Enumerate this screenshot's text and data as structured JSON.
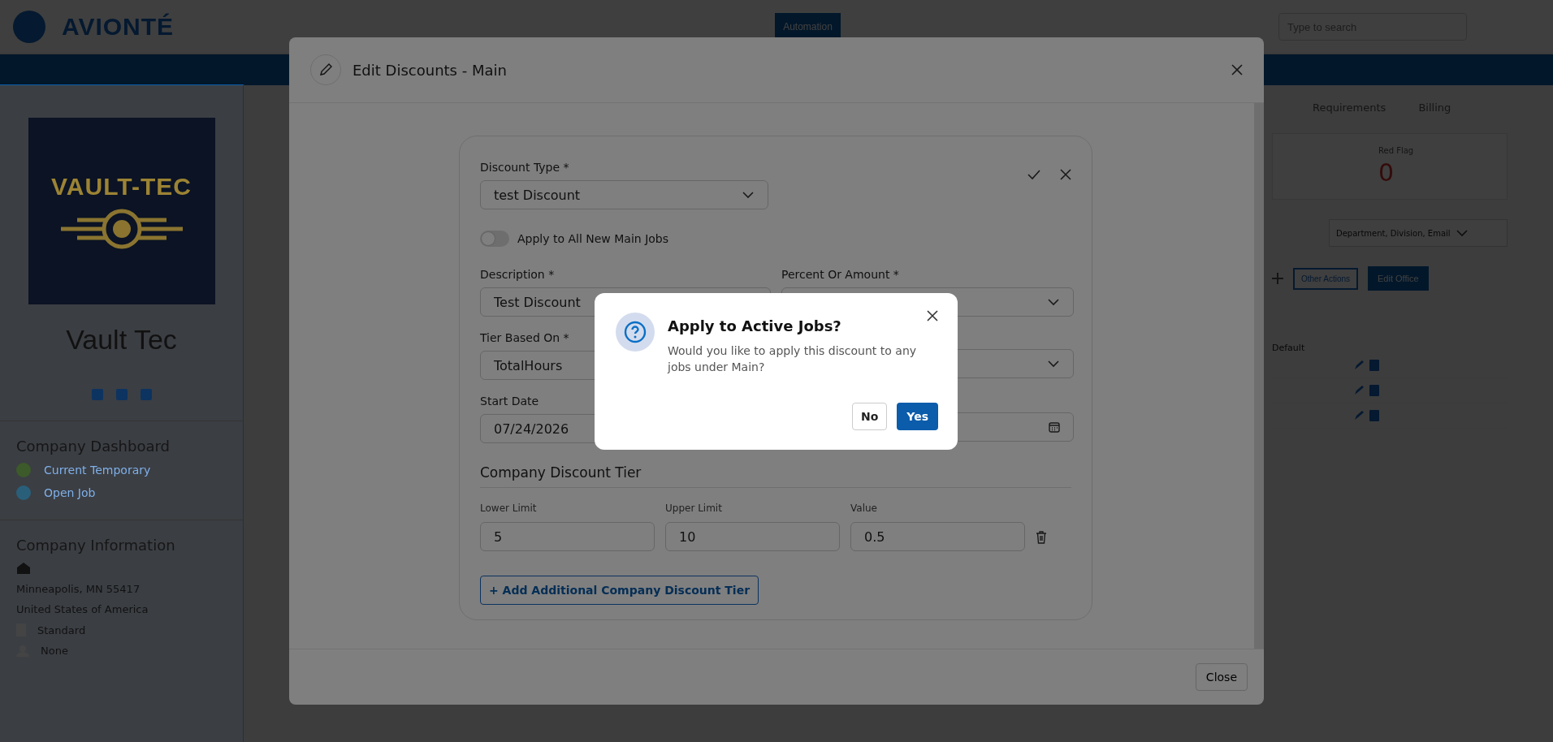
{
  "header": {
    "logo": "AVIONTÉ",
    "nav_button": "Automation",
    "search": {
      "placeholder": "Type to search"
    }
  },
  "sidebar": {
    "company_name": "Vault Tec",
    "logo_text": "VAULT-TEC",
    "dashboard_title": "Company Dashboard",
    "dashboard_items": [
      {
        "label": "Current Temporary",
        "color": "#3d5a2a"
      },
      {
        "label": "Open Job",
        "color": "#2a5f7a"
      }
    ],
    "info_title": "Company Information",
    "address_lines": [
      "Minneapolis, MN 55417",
      "United States of America"
    ],
    "attributes": [
      {
        "kind": "book",
        "label": "Standard"
      },
      {
        "kind": "person",
        "label": "None"
      }
    ]
  },
  "main": {
    "tabs": [
      "Requirements",
      "Billing"
    ],
    "stat": {
      "label": "Red Flag",
      "value": "0"
    },
    "filter": "Department, Division, Email",
    "other_actions": "Other Actions",
    "edit_office": "Edit Office",
    "table_header": "Default"
  },
  "modal": {
    "title": "Edit Discounts - Main",
    "close_button": "Close",
    "form": {
      "discount_type": {
        "label": "Discount Type *",
        "value": "test Discount"
      },
      "toggle": {
        "label": "Apply to All New Main Jobs",
        "on": false
      },
      "fields": [
        {
          "kind": "text",
          "label": "Description *",
          "value": "Test Discount"
        },
        {
          "kind": "select",
          "label": "Percent Or Amount *"
        },
        {
          "kind": "text",
          "label": "Tier Based On *",
          "value": "TotalHours"
        },
        {
          "kind": "select"
        },
        {
          "kind": "date",
          "label": "Start Date",
          "value": "07/24/2026"
        },
        {
          "kind": "date"
        }
      ],
      "tier_title": "Company Discount Tier",
      "tier_columns": [
        "Lower Limit",
        "Upper Limit",
        "Value"
      ],
      "tier_rows": [
        [
          "5",
          "10",
          "0.5"
        ]
      ],
      "add_tier": "+ Add Additional Company Discount Tier"
    }
  },
  "dialog": {
    "title": "Apply to Active Jobs?",
    "message": "Would you like to apply this discount to any jobs under Main?",
    "buttons": [
      {
        "label": "No",
        "kind": "secondary"
      },
      {
        "label": "Yes",
        "kind": "primary"
      }
    ]
  }
}
